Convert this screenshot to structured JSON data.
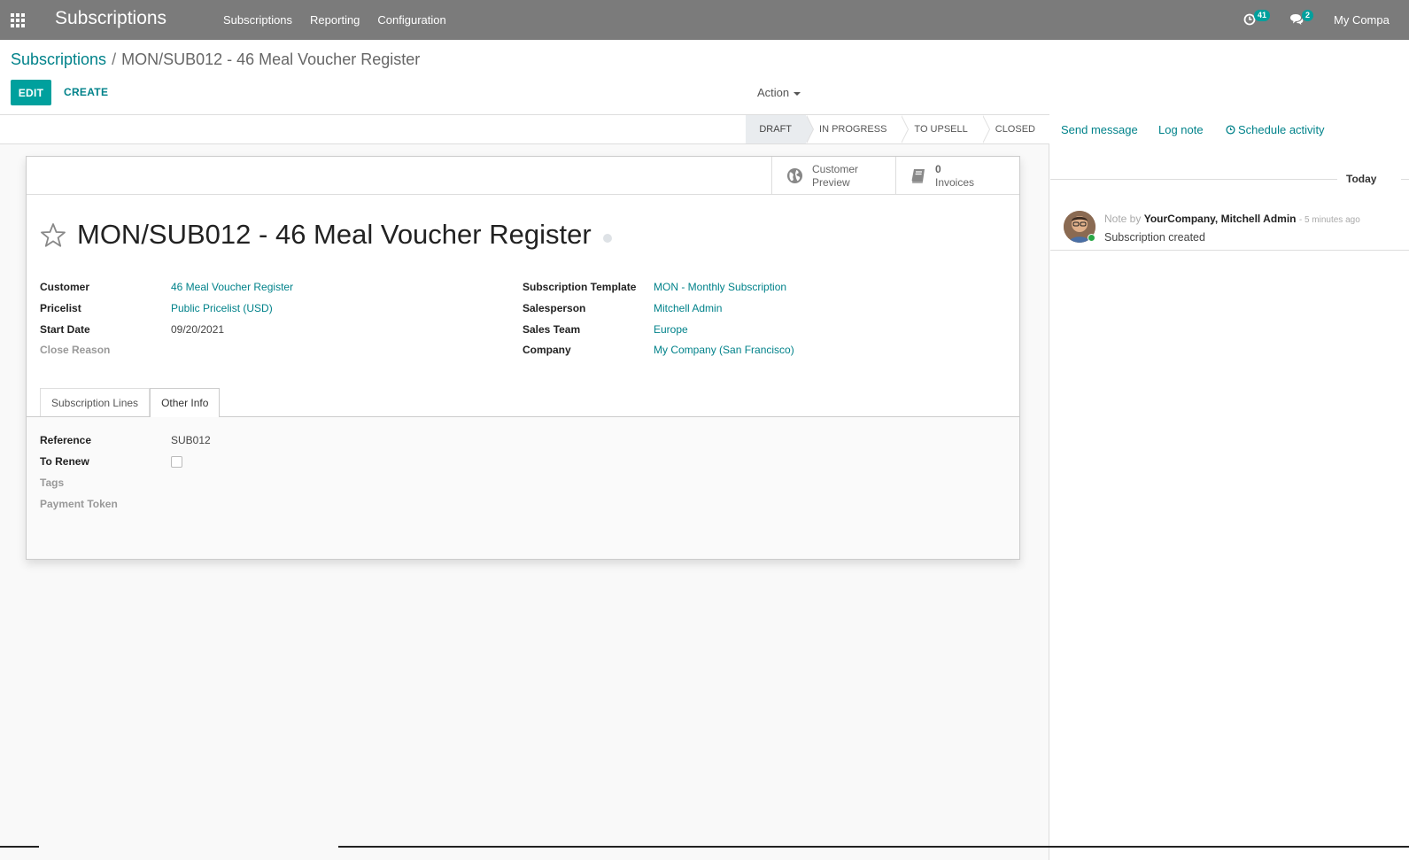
{
  "navbar": {
    "app_title": "Subscriptions",
    "menu": [
      "Subscriptions",
      "Reporting",
      "Configuration"
    ],
    "activity_count": "41",
    "message_count": "2",
    "company": "My Compa"
  },
  "breadcrumb": {
    "parent": "Subscriptions",
    "separator": "/",
    "current": "MON/SUB012 - 46 Meal Voucher Register"
  },
  "toolbar": {
    "edit_label": "EDIT",
    "create_label": "CREATE",
    "action_label": "Action"
  },
  "statusbar": {
    "steps": [
      "DRAFT",
      "IN PROGRESS",
      "TO UPSELL",
      "CLOSED"
    ],
    "active": "DRAFT"
  },
  "smart_buttons": {
    "customer_preview": {
      "line1": "Customer",
      "line2": "Preview",
      "icon": "globe-icon"
    },
    "invoices": {
      "count": "0",
      "label": "Invoices",
      "icon": "book-icon"
    }
  },
  "record": {
    "title": "MON/SUB012 - 46 Meal Voucher Register"
  },
  "fields_left": [
    {
      "label": "Customer",
      "value": "46 Meal Voucher Register"
    },
    {
      "label": "Pricelist",
      "value": "Public Pricelist (USD)"
    },
    {
      "label": "Start Date",
      "value": "09/20/2021"
    },
    {
      "label": "Close Reason",
      "value": ""
    }
  ],
  "fields_right": [
    {
      "label": "Subscription Template",
      "value": "MON - Monthly Subscription"
    },
    {
      "label": "Salesperson",
      "value": "Mitchell Admin"
    },
    {
      "label": "Sales Team",
      "value": "Europe"
    },
    {
      "label": "Company",
      "value": "My Company (San Francisco)"
    }
  ],
  "tabs": [
    "Subscription Lines",
    "Other Info"
  ],
  "active_tab": "Other Info",
  "other_info": [
    {
      "label": "Reference",
      "value": "SUB012"
    },
    {
      "label": "To Renew",
      "value": ""
    },
    {
      "label": "Tags",
      "value": ""
    },
    {
      "label": "Payment Token",
      "value": ""
    }
  ],
  "chatter": {
    "send_message": "Send message",
    "log_note": "Log note",
    "schedule_activity": "Schedule activity",
    "date_separator": "Today",
    "message": {
      "note_by": "Note by",
      "author": "YourCompany, Mitchell Admin",
      "date": "- 5 minutes ago",
      "body": "Subscription created"
    }
  },
  "colors": {
    "navbar": "#7b7b7b",
    "primary": "#00a09d",
    "link": "#00828a"
  }
}
